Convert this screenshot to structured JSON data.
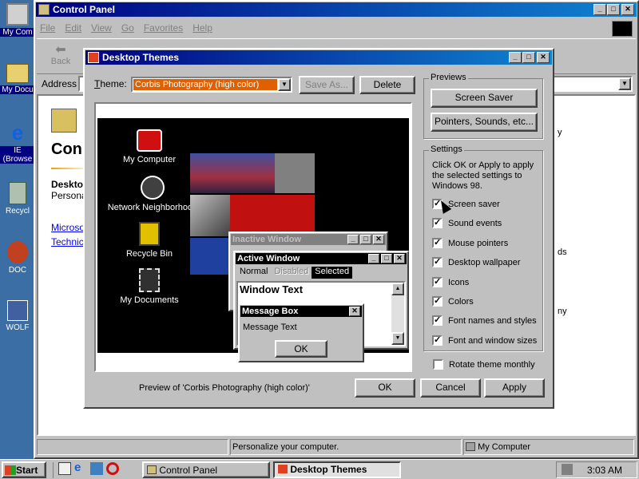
{
  "desktop": {
    "icons": [
      {
        "label": "My Com"
      },
      {
        "label": "My Docu"
      },
      {
        "label": "IE (Browse"
      },
      {
        "label": "Recycl"
      },
      {
        "label": "DOC"
      },
      {
        "label": "WOLF"
      }
    ]
  },
  "control_panel": {
    "title": "Control Panel",
    "menu": [
      "File",
      "Edit",
      "View",
      "Go",
      "Favorites",
      "Help"
    ],
    "back_label": "Back",
    "address_label": "Address",
    "heading": "Con",
    "desc_title": "Deskto",
    "desc_sub": "Persona",
    "link1": "Microso",
    "link2": "Technic",
    "right_text1": "y",
    "right_text2": "ds",
    "right_text3": "ny",
    "status_main": "Personalize your computer.",
    "status_right": "My Computer"
  },
  "dialog": {
    "title": "Desktop Themes",
    "theme_label": "Theme:",
    "theme_value": "Corbis Photography (high color)",
    "save_as": "Save As...",
    "delete": "Delete",
    "previews_group": "Previews",
    "screen_saver_btn": "Screen Saver",
    "pointers_btn": "Pointers, Sounds, etc...",
    "settings_group": "Settings",
    "settings_help": "Click OK or Apply to apply the selected settings to Windows 98.",
    "settings": [
      {
        "label": "Screen saver",
        "checked": true
      },
      {
        "label": "Sound events",
        "checked": true
      },
      {
        "label": "Mouse pointers",
        "checked": true
      },
      {
        "label": "Desktop wallpaper",
        "checked": true
      },
      {
        "label": "Icons",
        "checked": true
      },
      {
        "label": "Colors",
        "checked": true
      },
      {
        "label": "Font names and styles",
        "checked": true
      },
      {
        "label": "Font and window sizes",
        "checked": true
      }
    ],
    "rotate_label": "Rotate theme monthly",
    "preview_caption": "Preview of 'Corbis Photography (high color)'",
    "ok": "OK",
    "cancel": "Cancel",
    "apply": "Apply"
  },
  "preview": {
    "icons": [
      "My Computer",
      "Network Neighborhood",
      "Recycle Bin",
      "My Documents"
    ],
    "inactive_title": "Inactive Window",
    "active_title": "Active Window",
    "menu_normal": "Normal",
    "menu_disabled": "Disabled",
    "menu_selected": "Selected",
    "window_text": "Window Text",
    "msg_title": "Message Box",
    "msg_text": "Message Text",
    "msg_ok": "OK"
  },
  "taskbar": {
    "start": "Start",
    "tasks": [
      "Control Panel",
      "Desktop Themes"
    ],
    "time": "3:03 AM"
  },
  "colors": {
    "title_active": "#000080",
    "desktop": "#3a6ea5",
    "face": "#c0c0c0"
  }
}
